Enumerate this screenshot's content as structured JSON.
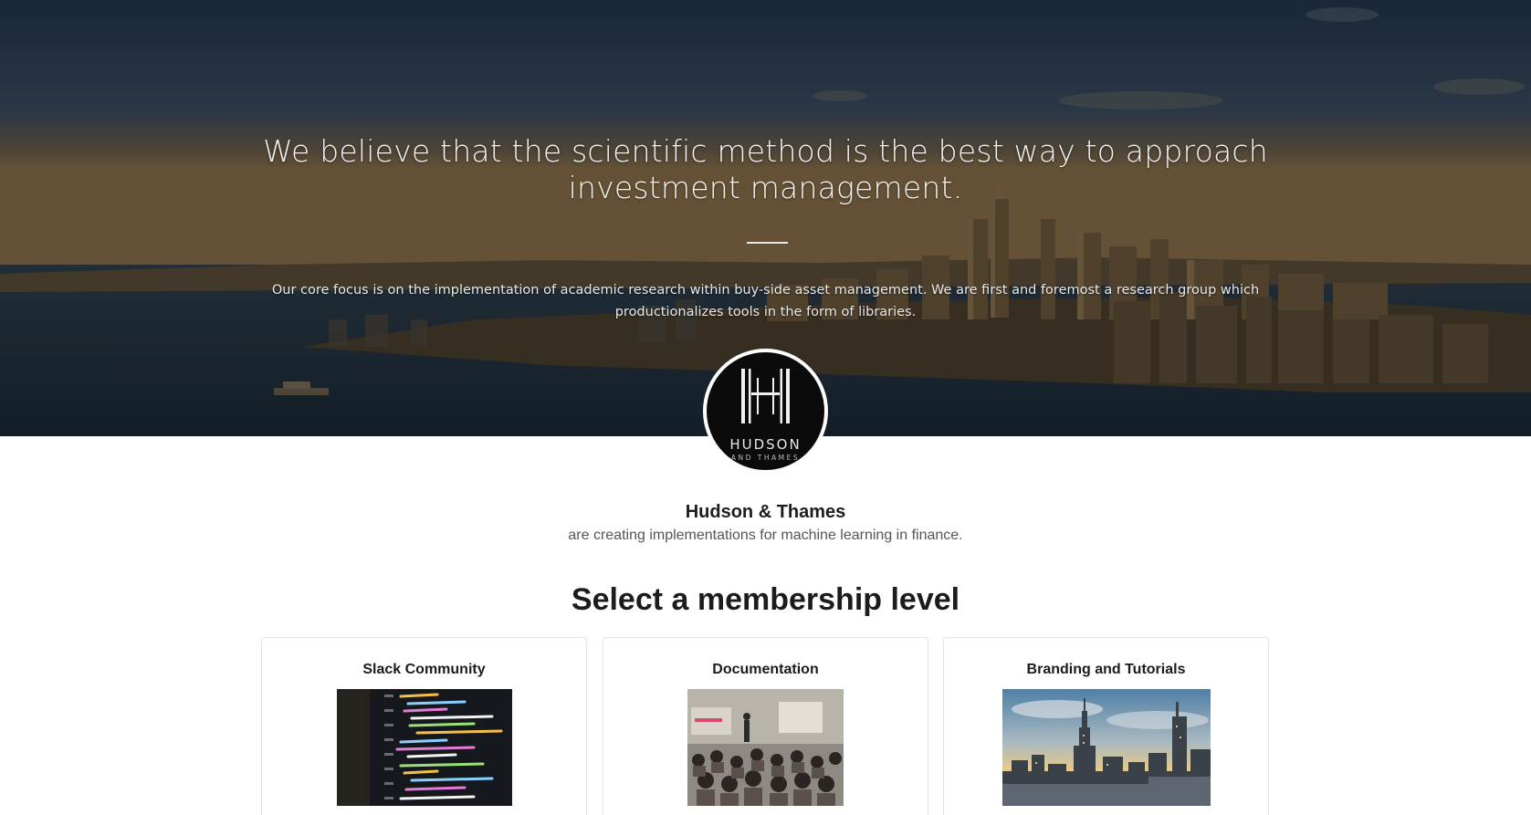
{
  "hero": {
    "headline": "We believe that the scientific method is the best way to approach investment management.",
    "subtext": "Our core focus is on the implementation of academic research within buy-side asset management. We are first and foremost a research group which productionalizes tools in the form of libraries."
  },
  "logo": {
    "word": "HUDSON",
    "subword": "AND THAMES"
  },
  "creator": {
    "name": "Hudson & Thames",
    "tagline": "are creating implementations for machine learning in finance."
  },
  "membership": {
    "section_title": "Select a membership level",
    "tiers": [
      {
        "title": "Slack Community",
        "image": "code-editor-photo"
      },
      {
        "title": "Documentation",
        "image": "lecture-hall-photo"
      },
      {
        "title": "Branding and Tutorials",
        "image": "city-skyline-photo"
      }
    ]
  },
  "colors": {
    "hero_overlay": "#24384e",
    "heading_text": "#1c1c1c",
    "muted_text": "#555555",
    "card_border": "#e3e3e3"
  }
}
